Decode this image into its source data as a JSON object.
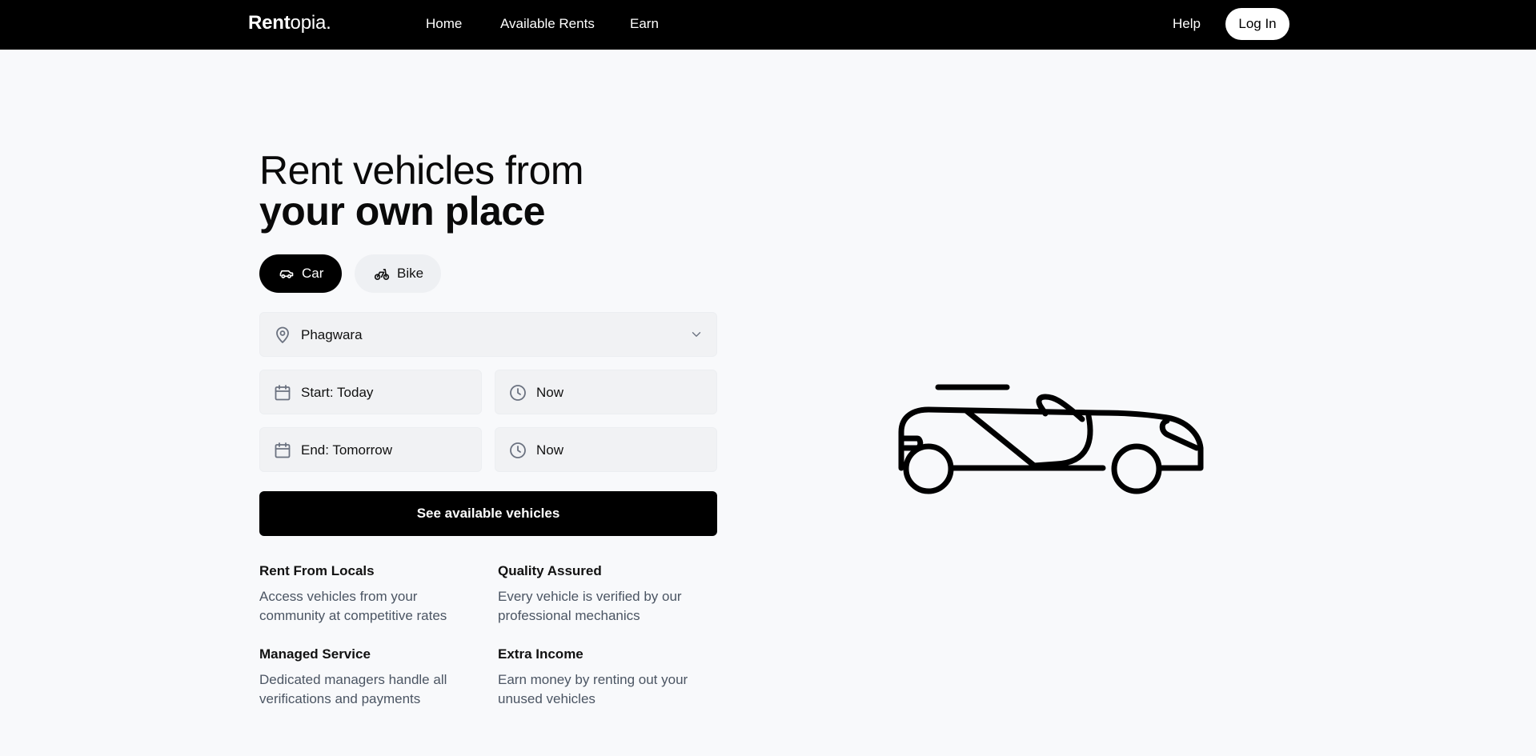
{
  "nav": {
    "brand_bold": "Rent",
    "brand_rest": "opia.",
    "links": [
      "Home",
      "Available Rents",
      "Earn"
    ],
    "help": "Help",
    "login": "Log In"
  },
  "hero": {
    "line1": "Rent vehicles from",
    "line2": "your own place"
  },
  "vehicle_types": [
    {
      "label": "Car",
      "icon": "car-icon",
      "selected": true
    },
    {
      "label": "Bike",
      "icon": "bike-icon",
      "selected": false
    }
  ],
  "form": {
    "location": "Phagwara",
    "start_date": "Start: Today",
    "start_time": "Now",
    "end_date": "End: Tomorrow",
    "end_time": "Now",
    "submit": "See available vehicles"
  },
  "features": [
    {
      "title": "Rent From Locals",
      "desc": "Access vehicles from your community at competitive rates"
    },
    {
      "title": "Quality Assured",
      "desc": "Every vehicle is verified by our professional mechanics"
    },
    {
      "title": "Managed Service",
      "desc": "Dedicated managers handle all verifications and payments"
    },
    {
      "title": "Extra Income",
      "desc": "Earn money by renting out your unused vehicles"
    }
  ],
  "colors": {
    "primary": "#000000",
    "background": "#f8f9fb",
    "field": "#f1f2f4",
    "muted_text": "#4b5563"
  }
}
